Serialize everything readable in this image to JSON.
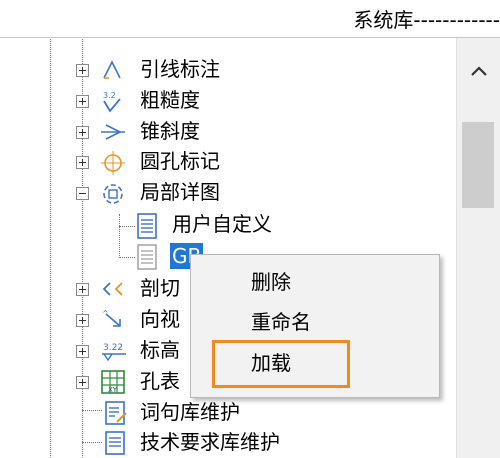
{
  "header": {
    "title": "系统库------------"
  },
  "tree": {
    "items": [
      {
        "label": "引线标注",
        "icon": "leader-annotation-icon",
        "expanded": false
      },
      {
        "label": "粗糙度",
        "icon": "roughness-icon",
        "icon_text": "3.2",
        "expanded": false
      },
      {
        "label": "锥斜度",
        "icon": "taper-icon",
        "expanded": false
      },
      {
        "label": "圆孔标记",
        "icon": "circle-hole-mark-icon",
        "expanded": false
      },
      {
        "label": "局部详图",
        "icon": "detail-view-icon",
        "expanded": true
      },
      {
        "label": "用户自定义",
        "icon": "document-icon"
      },
      {
        "label": "GB",
        "icon": "document-icon",
        "selected": true
      },
      {
        "label": "剖切",
        "icon": "section-cut-icon",
        "expanded": false
      },
      {
        "label": "向视",
        "icon": "view-direction-icon",
        "expanded": false
      },
      {
        "label": "标高",
        "icon": "elevation-icon",
        "icon_text": "3.22",
        "expanded": false
      },
      {
        "label": "孔表",
        "icon": "hole-table-icon",
        "icon_text": "XY",
        "expanded": false
      },
      {
        "label": "词句库维护",
        "icon": "list-edit-icon"
      },
      {
        "label": "技术要求库维护",
        "icon": "list-doc-icon"
      }
    ]
  },
  "context_menu": {
    "items": [
      {
        "label": "删除"
      },
      {
        "label": "重命名"
      },
      {
        "label": "加载"
      }
    ],
    "highlight_color": "#f08a1e"
  },
  "colors": {
    "selection": "#1e78d6",
    "icon_blue": "#3b73c8",
    "icon_orange": "#e8951e",
    "icon_green": "#2e8b3a"
  }
}
